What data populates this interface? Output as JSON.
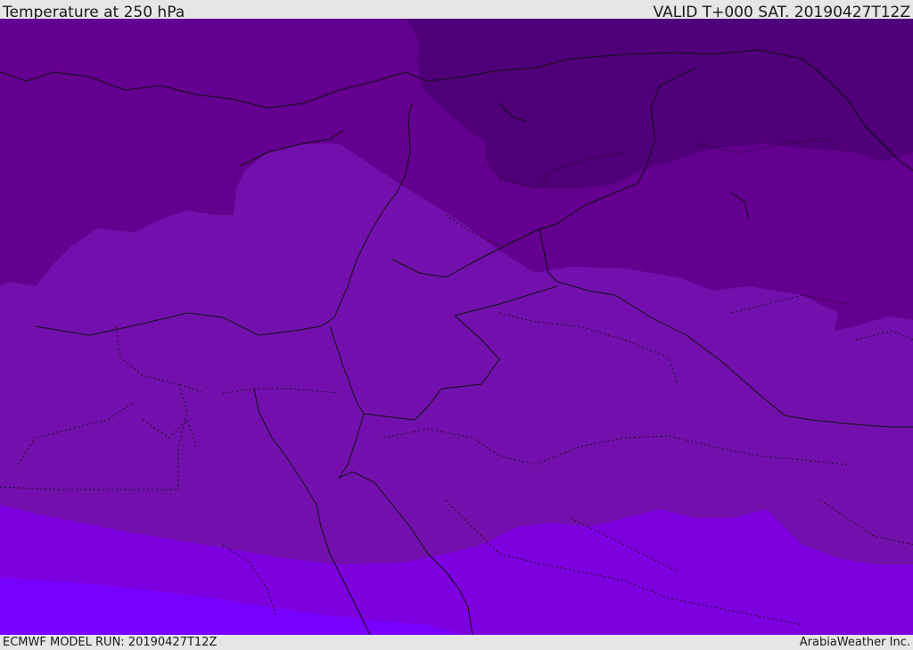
{
  "header": {
    "title": "Temperature at 250 hPa",
    "valid": "VALID T+000 SAT. 20190427T12Z"
  },
  "footer": {
    "model_run": "ECMWF MODEL RUN: 20190427T12Z",
    "credit": "ArabiaWeather Inc."
  },
  "map": {
    "colors": {
      "darkest": "#4f0078",
      "dark": "#63008f",
      "mid": "#7310ad",
      "light": "#7d00df",
      "lightest": "#7800ff"
    }
  }
}
